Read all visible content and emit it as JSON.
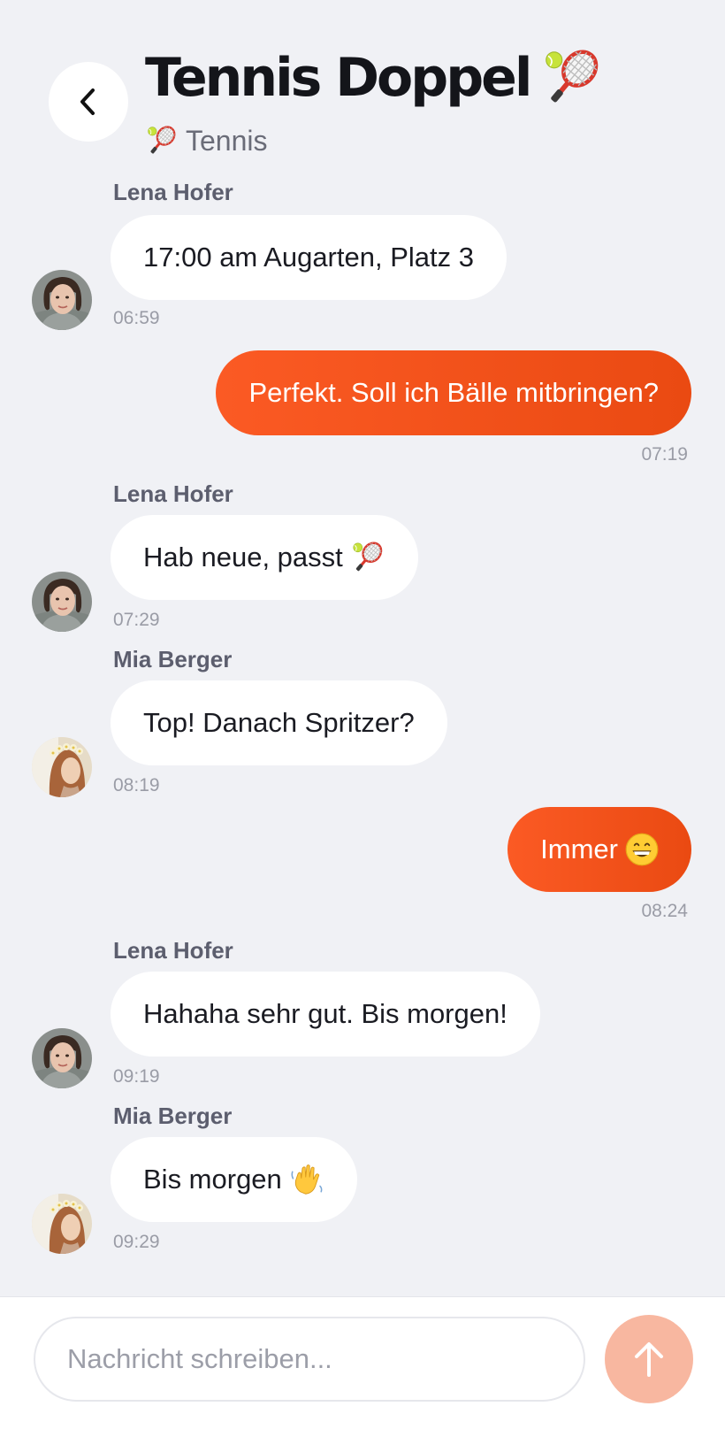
{
  "header": {
    "title": "Tennis Doppel",
    "title_icon": "tennis-racket-emoji",
    "subtitle": "Tennis",
    "subtitle_icon": "tennis-racket-emoji",
    "back_icon": "chevron-left-icon"
  },
  "messages": [
    {
      "direction": "in",
      "sender": "Lena Hofer",
      "text": "17:00 am Augarten, Platz 3",
      "time": "06:59",
      "avatar": "lena-hofer-avatar"
    },
    {
      "direction": "out",
      "text": "Perfekt. Soll ich Bälle mitbringen?",
      "time": "07:19"
    },
    {
      "direction": "in",
      "sender": "Lena Hofer",
      "text": "Hab neue, passt",
      "emoji": "tennis-racket-emoji",
      "time": "07:29",
      "avatar": "lena-hofer-avatar"
    },
    {
      "direction": "in",
      "sender": "Mia Berger",
      "text": "Top! Danach Spritzer?",
      "time": "08:19",
      "avatar": "mia-berger-avatar"
    },
    {
      "direction": "out",
      "text": "Immer",
      "emoji": "grinning-face-emoji",
      "time": "08:24"
    },
    {
      "direction": "in",
      "sender": "Lena Hofer",
      "text": "Hahaha sehr gut. Bis morgen!",
      "time": "09:19",
      "avatar": "lena-hofer-avatar"
    },
    {
      "direction": "in",
      "sender": "Mia Berger",
      "text": "Bis morgen",
      "emoji": "waving-hand-emoji",
      "time": "09:29",
      "avatar": "mia-berger-avatar"
    }
  ],
  "composer": {
    "placeholder": "Nachricht schreiben...",
    "value": "",
    "send_icon": "arrow-up-icon"
  },
  "colors": {
    "accent": "#F0541A",
    "send_disabled": "#F8B7A0",
    "background": "#F0F1F5"
  }
}
